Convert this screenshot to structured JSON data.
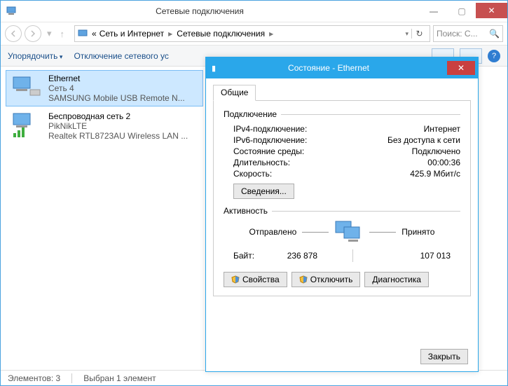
{
  "window": {
    "title": "Сетевые подключения",
    "controls": {
      "min": "—",
      "max": "▢",
      "close": "✕"
    }
  },
  "nav": {
    "crumb_prefix": "«",
    "crumb1": "Сеть и Интернет",
    "crumb2": "Сетевые подключения",
    "search_placeholder": "Поиск: С..."
  },
  "toolbar": {
    "organize": "Упорядочить",
    "disable": "Отключение сетевого ус",
    "help_char": "?"
  },
  "connections": [
    {
      "name": "Ethernet",
      "line2": "Сеть  4",
      "line3": "SAMSUNG Mobile USB Remote N..."
    },
    {
      "name": "Беспроводная сеть 2",
      "line2": "PikNikLTE",
      "line3": "Realtek RTL8723AU Wireless LAN ..."
    }
  ],
  "statusbar": {
    "count_label": "Элементов:",
    "count": "3",
    "selected_label": "Выбран 1 элемент"
  },
  "dialog": {
    "title": "Состояние - Ethernet",
    "tab": "Общие",
    "group_conn": "Подключение",
    "rows_conn": {
      "ipv4_l": "IPv4-подключение:",
      "ipv4_v": "Интернет",
      "ipv6_l": "IPv6-подключение:",
      "ipv6_v": "Без доступа к сети",
      "media_l": "Состояние среды:",
      "media_v": "Подключено",
      "dur_l": "Длительность:",
      "dur_v": "00:00:36",
      "speed_l": "Скорость:",
      "speed_v": "425.9 Мбит/с"
    },
    "details": "Сведения...",
    "group_act": "Активность",
    "sent": "Отправлено",
    "recv": "Принято",
    "bytes_l": "Байт:",
    "bytes_sent": "236 878",
    "bytes_recv": "107 013",
    "btn_props": "Свойства",
    "btn_disable": "Отключить",
    "btn_diag": "Диагностика",
    "btn_close": "Закрыть"
  }
}
